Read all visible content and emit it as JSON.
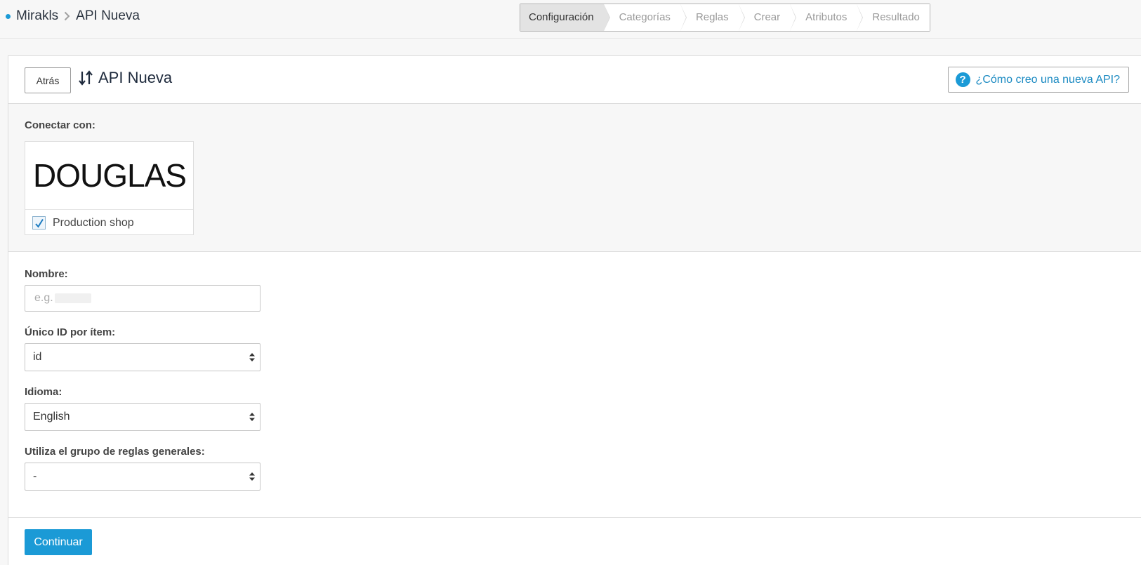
{
  "breadcrumb": {
    "root": "Mirakls",
    "current": "API Nueva"
  },
  "wizard": {
    "steps": [
      "Configuración",
      "Categorías",
      "Reglas",
      "Crear",
      "Atributos",
      "Resultado"
    ],
    "active_index": 0
  },
  "header": {
    "back_label": "Atrás",
    "title": "API Nueva",
    "help_label": "¿Cómo creo una nueva API?"
  },
  "connect": {
    "label": "Conectar con:",
    "shop_name": "DOUGLAS",
    "shop_option": "Production shop",
    "shop_checked": true
  },
  "form": {
    "name_label": "Nombre:",
    "name_placeholder": "e.g.",
    "name_value": "",
    "unique_id_label": "Único ID por ítem:",
    "unique_id_value": "id",
    "language_label": "Idioma:",
    "language_value": "English",
    "rules_label": "Utiliza el grupo de reglas generales:",
    "rules_value": "-"
  },
  "footer": {
    "continue_label": "Continuar"
  },
  "colors": {
    "accent": "#1b9ad6",
    "help_text": "#1b8ac2",
    "panel_bg": "#f7f7f7"
  },
  "icons": {
    "breadcrumb_separator": "chevron-right-icon",
    "title": "sort-arrows-icon",
    "help": "question-circle-icon",
    "select": "caret-updown-icon",
    "checkbox": "checkmark-icon"
  }
}
